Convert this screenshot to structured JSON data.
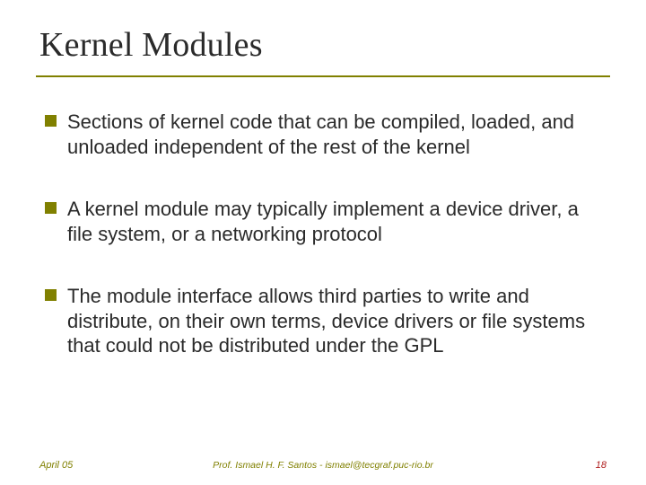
{
  "slide": {
    "title": "Kernel Modules",
    "bullets": [
      "Sections of kernel code that can be compiled, loaded, and unloaded independent of the rest of the kernel",
      "A kernel module may typically implement a device driver, a file system, or a networking protocol",
      "The module interface allows third parties to write and distribute, on their own terms, device drivers or file systems that could not be distributed under the GPL"
    ],
    "footer": {
      "left": "April 05",
      "center": "Prof. Ismael H. F. Santos - ismael@tecgraf.puc-rio.br",
      "right": "18"
    },
    "colors": {
      "accent": "#808000",
      "pagenum": "#b02020"
    }
  }
}
